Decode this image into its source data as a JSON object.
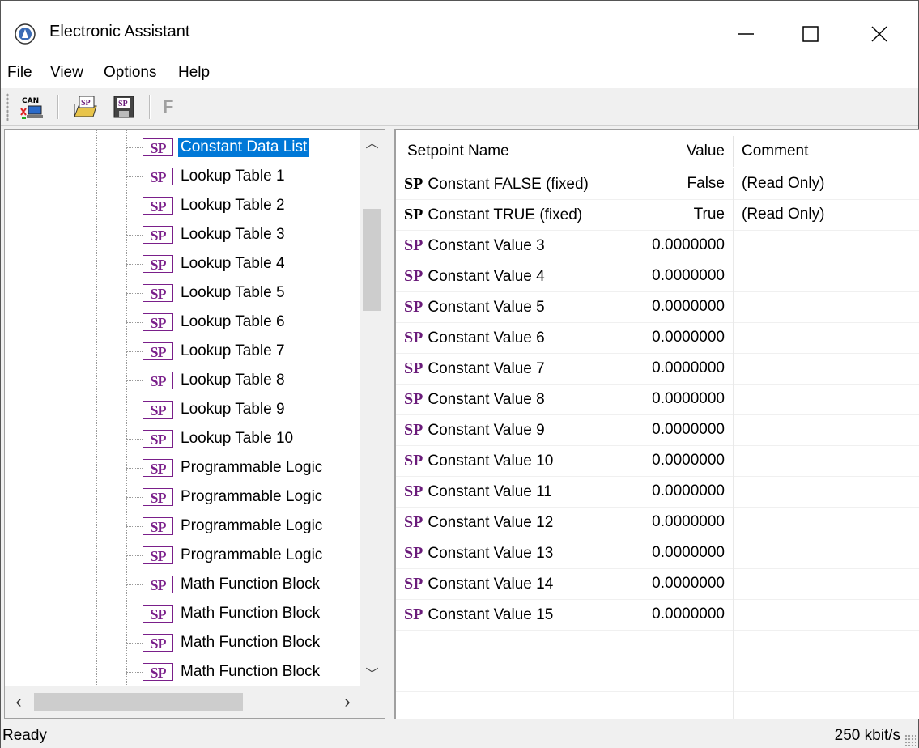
{
  "window": {
    "title": "Electronic Assistant",
    "controls": {
      "minimize": "—",
      "maximize": "☐",
      "close": "✕"
    }
  },
  "menu": [
    "File",
    "View",
    "Options",
    "Help"
  ],
  "toolbar": {
    "buttons": [
      "can-connect-icon",
      "open-setpoint-file-icon",
      "save-setpoint-file-icon"
    ],
    "f_label": "F"
  },
  "tree": {
    "icon_text": "SP",
    "items": [
      {
        "label": "Constant Data List",
        "selected": true
      },
      {
        "label": "Lookup Table 1"
      },
      {
        "label": "Lookup Table 2"
      },
      {
        "label": "Lookup Table 3"
      },
      {
        "label": "Lookup Table 4"
      },
      {
        "label": "Lookup Table 5"
      },
      {
        "label": "Lookup Table 6"
      },
      {
        "label": "Lookup Table 7"
      },
      {
        "label": "Lookup Table 8"
      },
      {
        "label": "Lookup Table 9"
      },
      {
        "label": "Lookup Table 10"
      },
      {
        "label": "Programmable Logic"
      },
      {
        "label": "Programmable Logic"
      },
      {
        "label": "Programmable Logic"
      },
      {
        "label": "Programmable Logic"
      },
      {
        "label": "Math Function Block"
      },
      {
        "label": "Math Function Block"
      },
      {
        "label": "Math Function Block"
      },
      {
        "label": "Math Function Block"
      }
    ]
  },
  "list": {
    "columns": [
      "Setpoint Name",
      "Value",
      "Comment"
    ],
    "sp_text": "SP",
    "rows": [
      {
        "name": "Constant FALSE (fixed)",
        "value": "False",
        "comment": "(Read Only)",
        "fixed": true
      },
      {
        "name": "Constant TRUE (fixed)",
        "value": "True",
        "comment": "(Read Only)",
        "fixed": true
      },
      {
        "name": "Constant Value 3",
        "value": "0.0000000",
        "comment": ""
      },
      {
        "name": "Constant Value 4",
        "value": "0.0000000",
        "comment": ""
      },
      {
        "name": "Constant Value 5",
        "value": "0.0000000",
        "comment": ""
      },
      {
        "name": "Constant Value 6",
        "value": "0.0000000",
        "comment": ""
      },
      {
        "name": "Constant Value 7",
        "value": "0.0000000",
        "comment": ""
      },
      {
        "name": "Constant Value 8",
        "value": "0.0000000",
        "comment": ""
      },
      {
        "name": "Constant Value 9",
        "value": "0.0000000",
        "comment": ""
      },
      {
        "name": "Constant Value 10",
        "value": "0.0000000",
        "comment": ""
      },
      {
        "name": "Constant Value 11",
        "value": "0.0000000",
        "comment": ""
      },
      {
        "name": "Constant Value 12",
        "value": "0.0000000",
        "comment": ""
      },
      {
        "name": "Constant Value 13",
        "value": "0.0000000",
        "comment": ""
      },
      {
        "name": "Constant Value 14",
        "value": "0.0000000",
        "comment": ""
      },
      {
        "name": "Constant Value 15",
        "value": "0.0000000",
        "comment": ""
      }
    ]
  },
  "status": {
    "left": "Ready",
    "right": "250 kbit/s"
  },
  "colors": {
    "selection": "#0078d7",
    "sp_purple": "#6a1b7a"
  }
}
